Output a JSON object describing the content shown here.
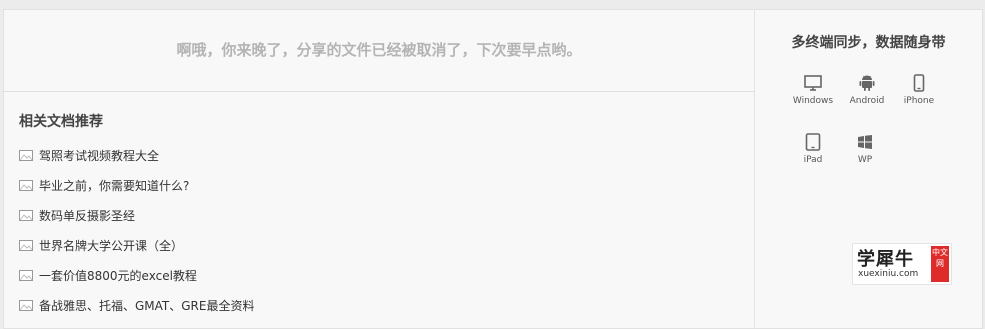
{
  "notice": "啊哦，你来晚了，分享的文件已经被取消了，下次要早点哟。",
  "related": {
    "title": "相关文档推荐",
    "items": [
      "驾照考试视频教程大全",
      "毕业之前，你需要知道什么?",
      "数码单反摄影圣经",
      "世界名牌大学公开课（全）",
      "一套价值8800元的excel教程",
      "备战雅思、托福、GMAT、GRE最全资料"
    ]
  },
  "sync": {
    "title": "多终端同步，数据随身带",
    "platforms": [
      {
        "label": "Windows",
        "icon": "monitor-icon"
      },
      {
        "label": "Android",
        "icon": "android-icon"
      },
      {
        "label": "iPhone",
        "icon": "phone-icon"
      },
      {
        "label": "iPad",
        "icon": "tablet-icon"
      },
      {
        "label": "WP",
        "icon": "windows-logo-icon"
      }
    ]
  },
  "logo": {
    "cn": "学犀牛",
    "en": "xuexiniu.com",
    "badge": "中文网"
  },
  "colors": {
    "notice_text": "#b4b4b4",
    "logo_badge": "#e02b2b"
  }
}
